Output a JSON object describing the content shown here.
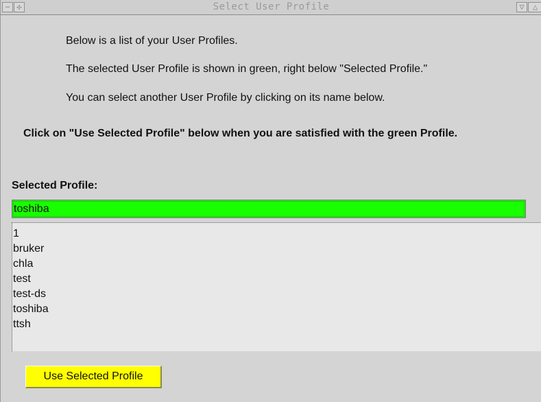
{
  "window": {
    "title": "Select User Profile"
  },
  "instructions": {
    "line1": "Below is a list of your User Profiles.",
    "line2": "The selected User Profile is shown in green, right below \"Selected Profile.\"",
    "line3": "You can select another User Profile by clicking on its name below.",
    "line4": "Click on \"Use Selected Profile\" below when you are satisfied with the green Profile."
  },
  "selected": {
    "label": "Selected Profile:",
    "value": "toshiba",
    "color": "#18ff00"
  },
  "profiles": [
    "1",
    "bruker",
    "chla",
    "test",
    "test-ds",
    "toshiba",
    "ttsh"
  ],
  "actions": {
    "use_label": "Use Selected Profile",
    "button_color": "#ffff00"
  }
}
